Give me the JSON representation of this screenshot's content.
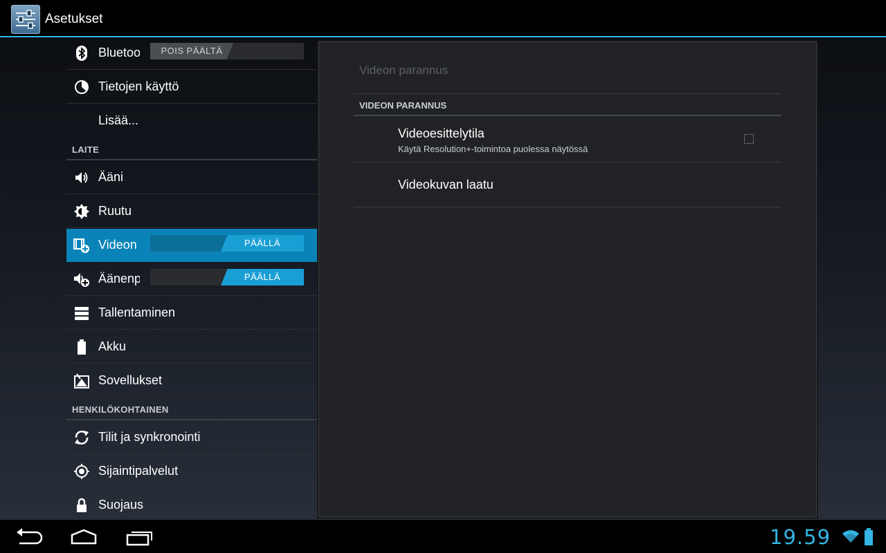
{
  "app": {
    "title": "Asetukset",
    "icon": "settings-sliders-icon"
  },
  "settings_list": {
    "items": [
      {
        "label": "Bluetooth",
        "icon": "bluetooth-icon",
        "toggle": "POIS PÄÄLTÄ",
        "toggle_on": false
      },
      {
        "label": "Tietojen käyttö",
        "icon": "data-usage-icon"
      },
      {
        "label": "Lisää...",
        "icon": ""
      },
      {
        "label": "Ääni",
        "icon": "sound-icon"
      },
      {
        "label": "Ruutu",
        "icon": "display-brightness-icon"
      },
      {
        "label": "Videon parannus",
        "icon": "video-enhance-icon",
        "toggle": "PÄÄLLÄ",
        "toggle_on": true,
        "selected": true
      },
      {
        "label": "Äänenparannus",
        "icon": "audio-enhance-icon",
        "toggle": "PÄÄLLÄ",
        "toggle_on": true
      },
      {
        "label": "Tallentaminen",
        "icon": "storage-icon"
      },
      {
        "label": "Akku",
        "icon": "battery-icon"
      },
      {
        "label": "Sovellukset",
        "icon": "apps-icon"
      },
      {
        "label": "Tilit ja synkronointi",
        "icon": "sync-icon"
      },
      {
        "label": "Sijaintipalvelut",
        "icon": "location-icon"
      },
      {
        "label": "Suojaus",
        "icon": "lock-icon"
      }
    ],
    "headers": {
      "device": "LAITE",
      "personal": "HENKILÖKOHTAINEN"
    }
  },
  "detail": {
    "title": "Videon parannus",
    "category": "VIDEON PARANNUS",
    "prefs": [
      {
        "title": "Videoesittelytila",
        "summary": "Käytä Resolution+-toimintoa puolessa näytössä",
        "checked": false
      },
      {
        "title": "Videokuvan laatu"
      }
    ]
  },
  "system_bar": {
    "clock": "19.59"
  },
  "colors": {
    "accent": "#33b5e5",
    "selected_row": "#0a84b8"
  }
}
